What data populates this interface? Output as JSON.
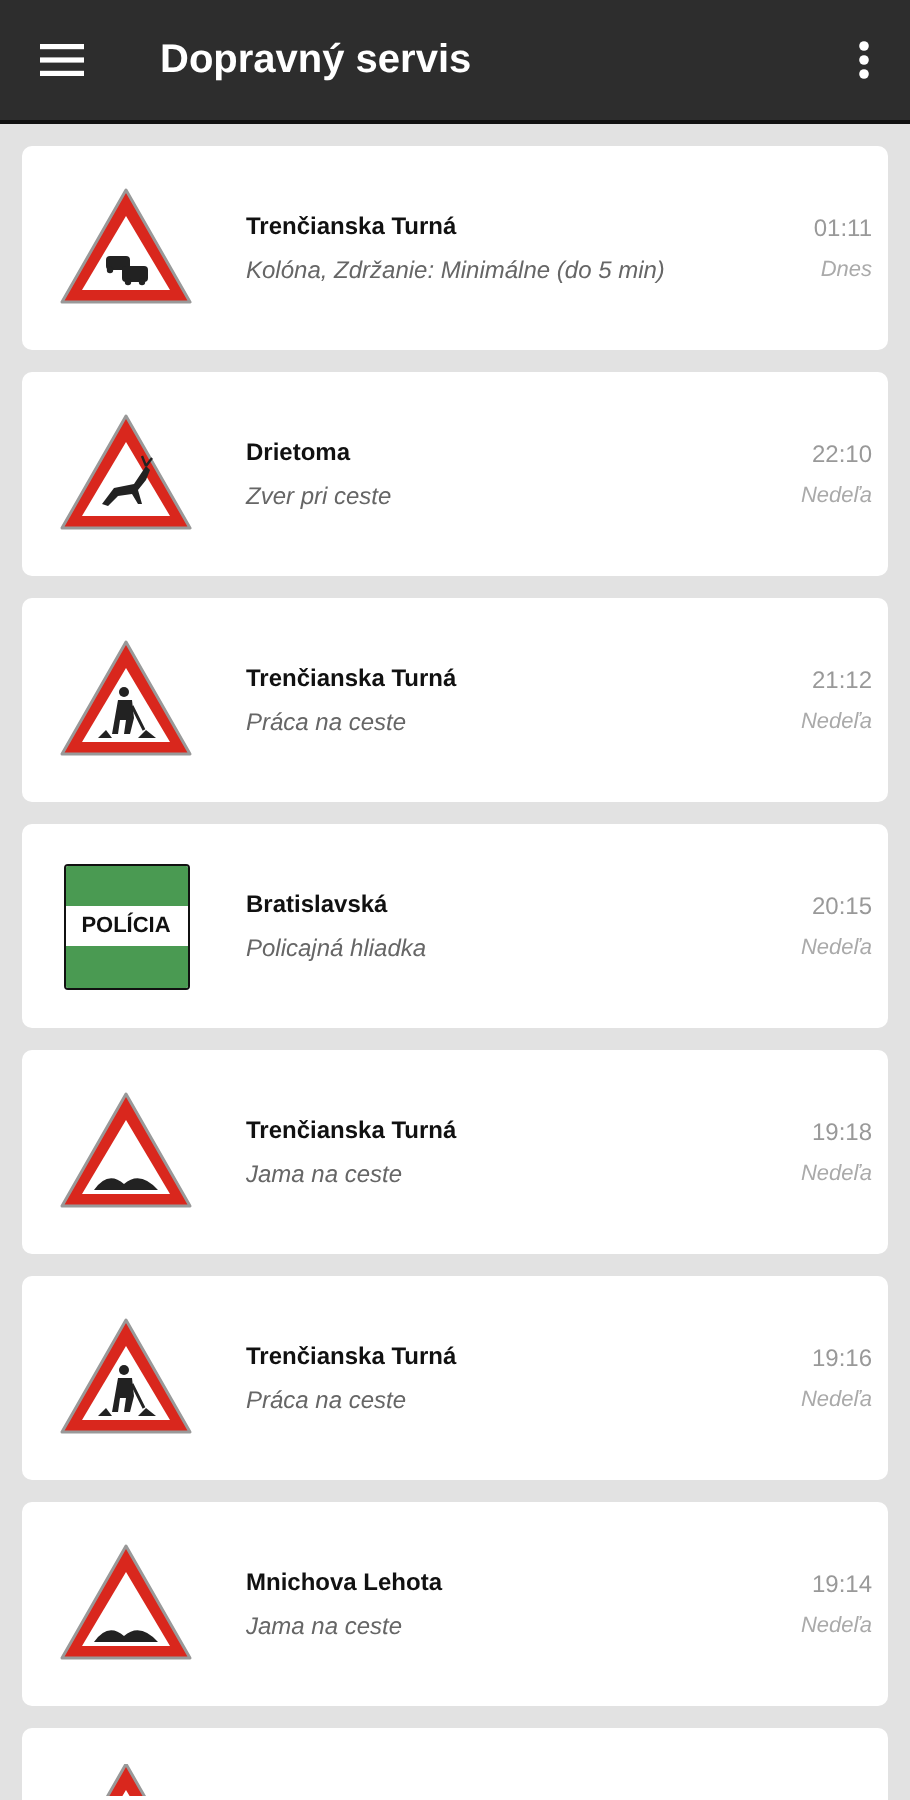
{
  "app_bar": {
    "title": "Dopravný servis"
  },
  "events": [
    {
      "kind": "queue",
      "place": "Trenčianska Turná",
      "description": "Kolóna, Zdržanie: Minimálne (do 5 min)",
      "time": "01:11",
      "day": "Dnes"
    },
    {
      "kind": "animals",
      "place": "Drietoma",
      "description": "Zver pri ceste",
      "time": "22:10",
      "day": "Nedeľa"
    },
    {
      "kind": "roadwork",
      "place": "Trenčianska Turná",
      "description": "Práca na ceste",
      "time": "21:12",
      "day": "Nedeľa"
    },
    {
      "kind": "police",
      "sign_text": "POLÍCIA",
      "place": "Bratislavská",
      "description": "Policajná hliadka",
      "time": "20:15",
      "day": "Nedeľa"
    },
    {
      "kind": "bump",
      "place": "Trenčianska Turná",
      "description": "Jama na ceste",
      "time": "19:18",
      "day": "Nedeľa"
    },
    {
      "kind": "roadwork",
      "place": "Trenčianska Turná",
      "description": "Práca na ceste",
      "time": "19:16",
      "day": "Nedeľa"
    },
    {
      "kind": "bump",
      "place": "Mnichova Lehota",
      "description": "Jama na ceste",
      "time": "19:14",
      "day": "Nedeľa"
    },
    {
      "kind": "warning"
    }
  ]
}
